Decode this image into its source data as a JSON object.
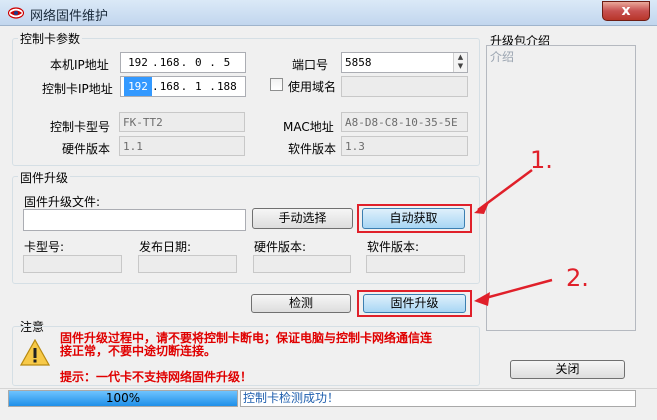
{
  "window": {
    "title": "网络固件维护",
    "close_label": "x"
  },
  "control": {
    "group_title": "控制卡参数",
    "local_ip_label": "本机IP地址",
    "local_ip": [
      "192",
      "168",
      "0",
      "5"
    ],
    "card_ip_label": "控制卡IP地址",
    "card_ip": [
      "192",
      "168",
      "1",
      "188"
    ],
    "port_label": "端口号",
    "port_value": "5858",
    "domain_label": "使用域名",
    "domain_value": "",
    "model_label": "控制卡型号",
    "model_value": "FK-TT2",
    "mac_label": "MAC地址",
    "mac_value": "A8-D8-C8-10-35-5E",
    "hw_label": "硬件版本",
    "hw_value": "1.1",
    "sw_label": "软件版本",
    "sw_value": "1.3"
  },
  "firmware": {
    "group_title": "固件升级",
    "file_label": "固件升级文件:",
    "file_value": "",
    "manual_btn": "手动选择",
    "auto_btn": "自动获取",
    "card_model_label": "卡型号:",
    "release_date_label": "发布日期:",
    "hw_label": "硬件版本:",
    "sw_label": "软件版本:",
    "detect_btn": "检测",
    "upgrade_btn": "固件升级"
  },
  "package": {
    "title": "升级包介绍",
    "subtitle": "介绍"
  },
  "notice": {
    "title": "注意",
    "line1": "固件升级过程中，请不要将控制卡断电；保证电脑与控制卡网络通信连",
    "line2": "接正常，不要中途切断连接。",
    "tip": "提示：一代卡不支持网络固件升级！"
  },
  "close_button": "关闭",
  "status": {
    "progress_text": "100%",
    "progress_value": 1.0,
    "message": "控制卡检测成功！"
  },
  "annotations": {
    "one": "1.",
    "two": "2."
  },
  "colors": {
    "accent": "#3399ff",
    "annotation_red": "#e0202a",
    "notice_red": "#e00000"
  }
}
